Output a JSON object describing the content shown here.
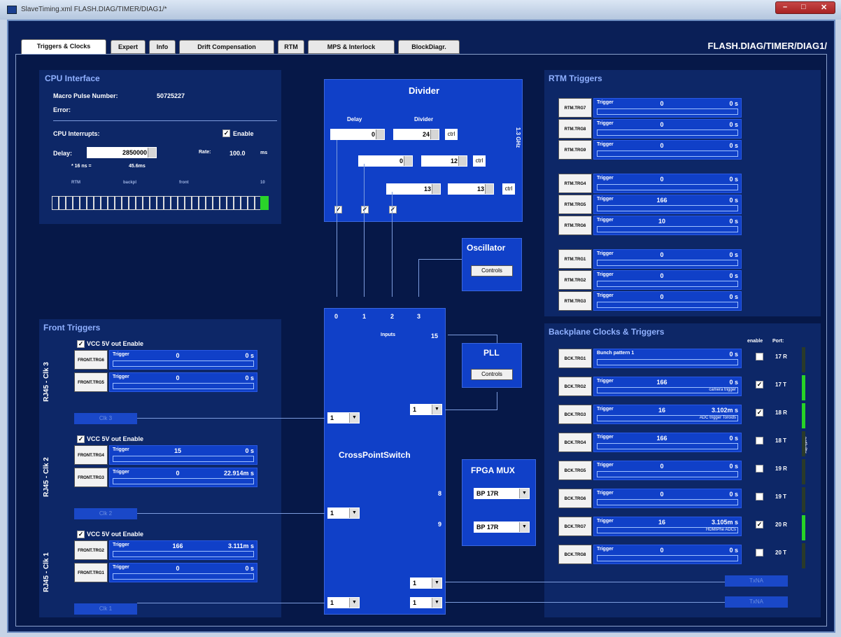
{
  "window": {
    "title": "SlaveTiming.xml  FLASH.DIAG/TIMER/DIAG1/*"
  },
  "tabs": [
    {
      "label": "Triggers & Clocks"
    },
    {
      "label": "Expert"
    },
    {
      "label": "Info"
    },
    {
      "label": "Drift Compensation"
    },
    {
      "label": "RTM"
    },
    {
      "label": "MPS & Interlock"
    },
    {
      "label": "BlockDiagr."
    }
  ],
  "header": {
    "title": "FLASH.DIAG/TIMER/DIAG1/"
  },
  "cpu": {
    "title": "CPU Interface",
    "mpn_label": "Macro Pulse Number:",
    "mpn_value": "50725227",
    "error_label": "Error:",
    "interrupts_label": "CPU Interrupts:",
    "enable_label": "Enable",
    "delay_label": "Delay:",
    "delay_value": "2850000",
    "rate_label": "Rate:",
    "rate_value": "100.0",
    "rate_unit": "ms",
    "delay_sub1": "* 16 ns =",
    "delay_sub2": "45.6ms",
    "scale": [
      "RTM",
      "backpl",
      "front",
      "10"
    ]
  },
  "divider": {
    "title": "Divider",
    "delay_label": "Delay",
    "divider_label": "Divider",
    "freq_label": "1.3 GHz",
    "rows": [
      {
        "delay": "0",
        "div": "24",
        "unit": "ctrl"
      },
      {
        "delay": "0",
        "div": "12",
        "unit": "ctrl"
      },
      {
        "delay": "13",
        "div": "13",
        "unit": "ctrl"
      }
    ]
  },
  "oscillator": {
    "title": "Oscillator",
    "button": "Controls"
  },
  "pll": {
    "title": "PLL",
    "button": "Controls"
  },
  "xps": {
    "title": "CrossPointSwitch",
    "inputs_label": "Inputs",
    "inputs_value": "15",
    "in_numbers": [
      "0",
      "1",
      "2",
      "3"
    ],
    "selects": [
      "1",
      "1",
      "1",
      "1",
      "1",
      "1"
    ]
  },
  "fpga": {
    "title": "FPGA MUX",
    "sel1": "BP 17R",
    "sel2": "BP 17R",
    "n1": "8",
    "n2": "9"
  },
  "rtm": {
    "title": "RTM Triggers",
    "rows": [
      {
        "btn": "RTM.TRG7",
        "label": "Trigger",
        "value": "0",
        "time": "0 s"
      },
      {
        "btn": "RTM.TRG8",
        "label": "Trigger",
        "value": "0",
        "time": "0 s"
      },
      {
        "btn": "RTM.TRG9",
        "label": "Trigger",
        "value": "0",
        "time": "0 s"
      },
      {
        "btn": "RTM.TRG4",
        "label": "Trigger",
        "value": "0",
        "time": "0 s"
      },
      {
        "btn": "RTM.TRG5",
        "label": "Trigger",
        "value": "166",
        "time": "0 s"
      },
      {
        "btn": "RTM.TRG6",
        "label": "Trigger",
        "value": "10",
        "time": "0 s"
      },
      {
        "btn": "RTM.TRG1",
        "label": "Trigger",
        "value": "0",
        "time": "0 s"
      },
      {
        "btn": "RTM.TRG2",
        "label": "Trigger",
        "value": "0",
        "time": "0 s"
      },
      {
        "btn": "RTM.TRG3",
        "label": "Trigger",
        "value": "0",
        "time": "0 s"
      }
    ]
  },
  "front": {
    "title": "Front Triggers",
    "vcc_label": "VCC 5V out Enable",
    "groups": [
      {
        "rj": "RJ45 - Clk 3",
        "clk": "Clk 3",
        "rows": [
          {
            "btn": "FRONT.TRG6",
            "label": "Trigger",
            "value": "0",
            "time": "0 s"
          },
          {
            "btn": "FRONT.TRG5",
            "label": "Trigger",
            "value": "0",
            "time": "0 s"
          }
        ]
      },
      {
        "rj": "RJ45 - Clk 2",
        "clk": "Clk 2",
        "rows": [
          {
            "btn": "FRONT.TRG4",
            "label": "Trigger",
            "value": "15",
            "time": "0 s"
          },
          {
            "btn": "FRONT.TRG3",
            "label": "Trigger",
            "value": "0",
            "time": "22.914m s"
          }
        ]
      },
      {
        "rj": "RJ45 - Clk 1",
        "clk": "Clk 1",
        "rows": [
          {
            "btn": "FRONT.TRG2",
            "label": "Trigger",
            "value": "166",
            "time": "3.111m s"
          },
          {
            "btn": "FRONT.TRG1",
            "label": "Trigger",
            "value": "0",
            "time": "0 s"
          }
        ]
      }
    ]
  },
  "backplane": {
    "title": "Backplane Clocks & Triggers",
    "enable_label": "enable",
    "port_label": "Port:",
    "vert_label": "activity",
    "rows": [
      {
        "btn": "BCK.TRG1",
        "label": "Bunch pattern 1",
        "value": "",
        "time": "0 s",
        "desc": "",
        "en": false,
        "port": "17 R",
        "led": false
      },
      {
        "btn": "BCK.TRG2",
        "label": "Trigger",
        "value": "166",
        "time": "0 s",
        "desc": "camera trigger",
        "en": true,
        "port": "17 T",
        "led": true
      },
      {
        "btn": "BCK.TRG3",
        "label": "Trigger",
        "value": "16",
        "time": "3.102m s",
        "desc": "ADC trigger Toroids",
        "en": true,
        "port": "18 R",
        "led": true
      },
      {
        "btn": "BCK.TRG4",
        "label": "Trigger",
        "value": "166",
        "time": "0 s",
        "desc": "",
        "en": false,
        "port": "18 T",
        "led": false
      },
      {
        "btn": "BCK.TRG5",
        "label": "Trigger",
        "value": "0",
        "time": "0 s",
        "desc": "",
        "en": false,
        "port": "19 R",
        "led": false
      },
      {
        "btn": "BCK.TRG6",
        "label": "Trigger",
        "value": "0",
        "time": "0 s",
        "desc": "",
        "en": false,
        "port": "19 T",
        "led": false
      },
      {
        "btn": "BCK.TRG7",
        "label": "Trigger",
        "value": "16",
        "time": "3.105m s",
        "desc": "HDMIPhe ADCs",
        "en": true,
        "port": "20 R",
        "led": true
      },
      {
        "btn": "BCK.TRG8",
        "label": "Trigger",
        "value": "0",
        "time": "0 s",
        "desc": "",
        "en": false,
        "port": "20 T",
        "led": false
      }
    ],
    "tx": [
      "TxNA",
      "TxNA"
    ]
  }
}
